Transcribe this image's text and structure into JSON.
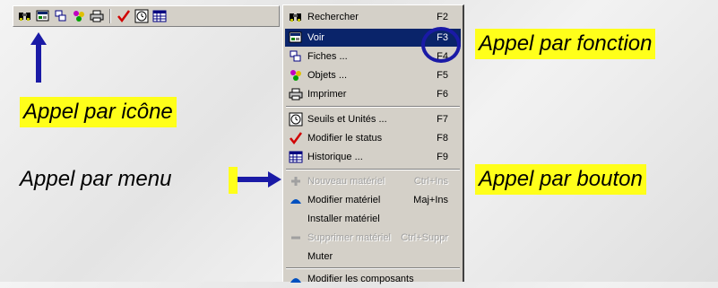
{
  "menu": {
    "items": [
      {
        "label": "Rechercher",
        "shortcut": "F2",
        "icon": "binoculars-icon",
        "state": "normal"
      },
      {
        "label": "Voir",
        "shortcut": "F3",
        "icon": "view-icon",
        "state": "selected"
      },
      {
        "label": "Fiches ...",
        "shortcut": "F4",
        "icon": "cards-icon",
        "state": "normal"
      },
      {
        "label": "Objets ...",
        "shortcut": "F5",
        "icon": "objects-icon",
        "state": "normal"
      },
      {
        "label": "Imprimer",
        "shortcut": "F6",
        "icon": "printer-icon",
        "state": "normal"
      },
      {
        "label": "Seuils et Unités ...",
        "shortcut": "F7",
        "icon": "clock-icon",
        "state": "normal"
      },
      {
        "label": "Modifier le status",
        "shortcut": "F8",
        "icon": "checkmark-icon",
        "state": "normal"
      },
      {
        "label": "Historique ...",
        "shortcut": "F9",
        "icon": "grid-icon",
        "state": "normal"
      },
      {
        "label": "Nouveau matériel",
        "shortcut": "Ctrl+Ins",
        "icon": "plus-icon",
        "state": "disabled"
      },
      {
        "label": "Modifier matériel",
        "shortcut": "Maj+Ins",
        "icon": "triangle-icon",
        "state": "normal"
      },
      {
        "label": "Installer matériel",
        "shortcut": "",
        "icon": "",
        "state": "normal"
      },
      {
        "label": "Supprimer matériel",
        "shortcut": "Ctrl+Suppr",
        "icon": "minus-icon",
        "state": "disabled"
      },
      {
        "label": "Muter",
        "shortcut": "",
        "icon": "",
        "state": "normal"
      },
      {
        "label": "Modifier les composants",
        "shortcut": "",
        "icon": "triangle-icon",
        "state": "normal"
      }
    ]
  },
  "toolbar": {
    "icons": [
      "binoculars-icon",
      "view-icon",
      "cards-icon",
      "objects-icon",
      "printer-icon",
      "checkmark-icon",
      "clock-icon",
      "grid-icon"
    ]
  },
  "callouts": {
    "function": "Appel par fonction",
    "icon": "Appel par icône",
    "menu": "Appel par menu",
    "button": "Appel par bouton"
  },
  "colors": {
    "highlight": "#ffff1a",
    "arrow": "#1a1aa6",
    "menu_selected": "#0a246a"
  }
}
